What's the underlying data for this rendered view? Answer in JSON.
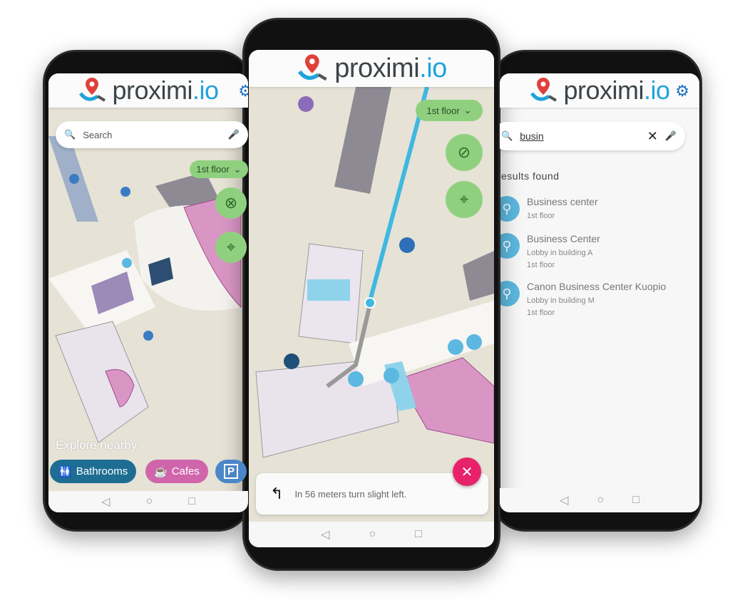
{
  "brand": {
    "name_a": "proximi",
    "name_b": ".io",
    "accent": "#1fa3dc",
    "pin": "#e0403a"
  },
  "left": {
    "search_placeholder": "Search",
    "floor": "1st floor",
    "explore": "Explore nearby",
    "chips": [
      {
        "label": "Bathrooms",
        "color": "#1d6e92",
        "icon": "restroom-icon"
      },
      {
        "label": "Cafes",
        "color": "#d065ab",
        "icon": "cup-icon"
      },
      {
        "label": "P",
        "color": "#4a86c8",
        "icon": "parking-icon"
      }
    ]
  },
  "middle": {
    "floor": "1st floor",
    "instruction": "In 56 meters turn slight left.",
    "close_color": "#e8226a"
  },
  "right": {
    "search_value": "busin",
    "results_heading": "esults found",
    "results": [
      {
        "title": "Business center",
        "lines": [
          "1st floor"
        ]
      },
      {
        "title": "Business Center",
        "lines": [
          "Lobby in building A",
          "1st floor"
        ]
      },
      {
        "title": "Canon Business Center Kuopio",
        "lines": [
          "Lobby in building M",
          "1st floor"
        ]
      }
    ]
  },
  "nav": {
    "back": "◁",
    "home": "○",
    "recent": "□"
  }
}
